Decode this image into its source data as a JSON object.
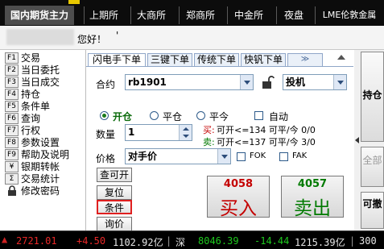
{
  "topbar": {
    "tabs": [
      {
        "label": "国内期货主力",
        "active": true
      },
      {
        "label": "上期所",
        "active": false
      },
      {
        "label": "大商所",
        "active": false
      },
      {
        "label": "郑商所",
        "active": false
      },
      {
        "label": "中金所",
        "active": false
      },
      {
        "label": "夜盘",
        "active": false
      },
      {
        "label": "LME伦敦金属",
        "active": false
      }
    ]
  },
  "greeting": {
    "hello": "您好！",
    "mark": "'"
  },
  "menu": {
    "items": [
      {
        "key": "F1",
        "label": "交易"
      },
      {
        "key": "F2",
        "label": "当日委托"
      },
      {
        "key": "F3",
        "label": "当日成交"
      },
      {
        "key": "F4",
        "label": "持仓"
      },
      {
        "key": "F5",
        "label": "条件单"
      },
      {
        "key": "F6",
        "label": "查询"
      },
      {
        "key": "F7",
        "label": "行权"
      },
      {
        "key": "F8",
        "label": "参数设置"
      },
      {
        "key": "F9",
        "label": "帮助及说明"
      },
      {
        "key": "¥",
        "label": "银期转帐"
      },
      {
        "key": "Σ",
        "label": "交易统计"
      },
      {
        "key": "",
        "label": "修改密码"
      }
    ]
  },
  "order": {
    "tabs": [
      "闪电手下单",
      "三键下单",
      "传统下单",
      "快钒下单"
    ],
    "chevron": "≫",
    "contract_label": "合约",
    "contract_value": "rb1901",
    "hedge_value": "投机",
    "open_label": "开仓",
    "close_label": "平仓",
    "close_today_label": "平今",
    "auto_label": "自动",
    "qty_label": "数量",
    "qty_value": "1",
    "buy_info_label": "买:",
    "buy_info": "可开<=134  可平/今 0/0",
    "sell_info_label": "卖:",
    "sell_info": "可开<=137  可平/今 3/0",
    "price_label": "价格",
    "price_value": "对手价",
    "fok_label": "FOK",
    "fak_label": "FAK",
    "query_open_label": "查可开",
    "reset_label": "复位",
    "condition_label": "条件",
    "inquiry_label": "询价",
    "buy_price": "4058",
    "buy_label": "买入",
    "sell_price": "4057",
    "sell_label": "卖出"
  },
  "side": {
    "hold_label": "持仓",
    "all_label": "全部",
    "cancel_label": "可撤"
  },
  "ticker": {
    "items": [
      {
        "text": "2721.01",
        "color": "#e82828"
      },
      {
        "text": "+4.50",
        "color": "#e82828"
      },
      {
        "text": "1102.92亿",
        "color": "#e6e6e6"
      },
      {
        "text": "|",
        "color": "#999999"
      },
      {
        "text": "深",
        "color": "#e6e6e6"
      },
      {
        "text": "8046.39",
        "color": "#1ec81e"
      },
      {
        "text": "-14.44",
        "color": "#1ec81e"
      },
      {
        "text": "1215.39亿",
        "color": "#e6e6e6"
      },
      {
        "text": "|",
        "color": "#999999"
      },
      {
        "text": "300",
        "color": "#e6e6e6"
      }
    ]
  },
  "colors": {
    "buy": "#c40000",
    "sell": "#007a00",
    "highlight_box": "#e02020"
  }
}
